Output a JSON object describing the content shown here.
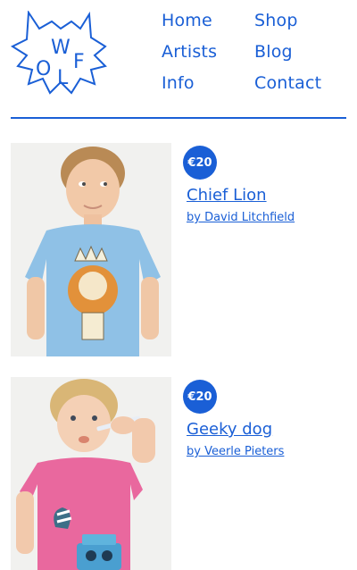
{
  "brand": {
    "logo_letters": [
      "W",
      "O",
      "L",
      "F"
    ],
    "color": "#1a5fd6"
  },
  "nav": {
    "items": [
      {
        "label": "Home"
      },
      {
        "label": "Shop"
      },
      {
        "label": "Artists"
      },
      {
        "label": "Blog"
      },
      {
        "label": "Info"
      },
      {
        "label": "Contact"
      }
    ]
  },
  "products": [
    {
      "price": "€20",
      "title": "Chief Lion",
      "artist": "by David Litchfield",
      "shirt_color": "#8fc1e6"
    },
    {
      "price": "€20",
      "title": "Geeky dog",
      "artist": "by Veerle Pieters",
      "shirt_color": "#e9689e"
    }
  ]
}
